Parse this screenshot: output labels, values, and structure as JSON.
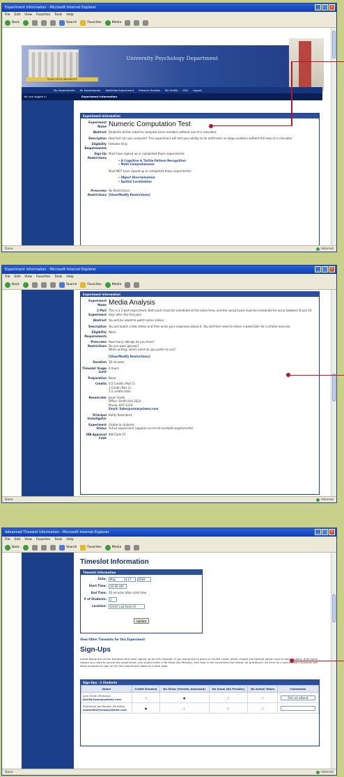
{
  "w1": {
    "title": "Experiment Information - Microsoft Internet Explorer",
    "menu": [
      "File",
      "Edit",
      "View",
      "Favorites",
      "Tools",
      "Help"
    ],
    "toolbar": {
      "back": "Back",
      "search": "Search",
      "favorites": "Favorites",
      "media": "Media"
    },
    "banner_title": "University Psychology Department",
    "banner_strip": "TEXAS TECH UNIVERSITY",
    "nav": [
      "My Experiments",
      "All Experiments",
      "Add/View Experiment",
      "Protocol Studies",
      "My Profile",
      "FAQ",
      "Logout"
    ],
    "logged_in": "You are logged in",
    "section": "Experiment Information",
    "panel_header": "Experiment Information",
    "name_k": "Experiment Name",
    "name_v": "Numeric Computation Test",
    "abstract_k": "Abstract",
    "abstract_v": "Students will be asked to compute some numbers without use of a calculator.",
    "desc_k": "Description",
    "desc_v": "How fast can you compute? This experiment will test your ability to do arithmetic on large numbers without the help of a calculator.",
    "elig_k": "Eligibility Requirements",
    "elig_v": "Females Only",
    "sign_k": "Sign-Up Restrictions",
    "sign_v": "Must have signed up or completed these experiments:",
    "sign_l1": "A Cognitive & Tactile Pattern Recognition",
    "sign_l2": "Math Comprehension",
    "sign_not": "Must NOT have signed up or completed these experiments:",
    "sign_l3": "Object Discrimination",
    "sign_l4": "Spatial Localization",
    "prescreen_k": "Prescreen Restrictions",
    "prescreen_v": "No Restrictions",
    "prescreen_link": "[View/Modify Restrictions]",
    "status": "Done",
    "zone": "Internet"
  },
  "w2": {
    "title": "Experiment Information - Microsoft Internet Explorer",
    "panel_header": "Experiment Information",
    "name_k": "Experiment Name",
    "name_v": "Media Analysis",
    "twopart_k": "2-Part Experiment",
    "twopart_v": "This is a 2-part experiment. Both parts must be scheduled at the same time, and the second part must be scheduled for occur between 8 and 10 days after the first part.",
    "abstract_k": "Abstract",
    "abstract_v": "You will be asked to watch some videos.",
    "desc_k": "Description",
    "desc_v": "You will watch a few videos and then write your responses about it. You will then need to return a week later for a similar exercise.",
    "elig_k": "Eligibility Requirements",
    "elig_v": "None",
    "pre_k": "Prescreen Restrictions",
    "pre_v1": "How many siblings do you have?",
    "pre_v2": "Do you wear glasses?",
    "pre_v3": "When writing, which hand do you prefer to use?",
    "pre_link": "[View/Modify Restrictions]",
    "dur_k": "Duration",
    "dur_v": "30 minutes",
    "tl_k": "Timeslot Usage Limit",
    "tl_v": "4 hours",
    "prep_k": "Preparation",
    "prep_v": "None",
    "cred_k": "Credits",
    "cred_v1": "0.5 Credits (Part 1)",
    "cred_v2": "1 Credit (Part 2)",
    "cred_v3": "1.5 credits total",
    "res_k": "Researcher",
    "res_v1": "Jason Smith",
    "res_v2": "Office: Smith Hall 302a",
    "res_v3": "Phone: 607-1234",
    "res_v4": "Email: Sales@sonasystems.com",
    "pi_k": "Principal Investigator",
    "pi_v": "Kathy Rosenburt",
    "es_k": "Experiment Status",
    "es_v1": "Visible to students",
    "es_v2": "Active experiment (appears on list of available experiments)",
    "irb_k": "IRB Approval Code",
    "irb_v": "IRB Code 07",
    "status": "Done",
    "zone": "Internet"
  },
  "w3": {
    "title": "Advanced Timeslot Information - Microsoft Internet Explorer",
    "heading": "Timeslot Information",
    "panel_header": "Timeslot Information",
    "date_k": "Date:",
    "date_m": "May",
    "date_d": "17",
    "date_y": "2004",
    "start_k": "Start Time:",
    "start_v": "10:00 AM",
    "end_k": "End Time:",
    "end_v": "30 minutes after start time",
    "num_k": "# of Students:",
    "num_v": "2",
    "loc_k": "Location:",
    "loc_v": "Smith Lab Room B",
    "update": "Update",
    "view_link": "View Other Timeslots for this Experiment",
    "signups": "Sign-Ups",
    "signups_text": "Listed below are all the students who have signed up for this timeslot. If you would like to grant or revoke credit, either choose the desired option next to each student. If for some reason you need to cancel the experiment, you should enter a No Show (No Penalty), and note in the comments the reason for granting it. An Error as a cancellation (Going on will allow students to sign up for this experiment again at a later date.",
    "tbl_caption": "Sign-Ups - 2 Students",
    "cols": [
      "Name",
      "Credit Granted",
      "No Show (Penalty Assessed)",
      "No Show (No Penalty)",
      "No Action Taken",
      "Comments"
    ],
    "r1_name": "John Smith (Pinkstar)",
    "r1_email": "jsmith@sonasystems.com",
    "r1_comment": "Did not attend",
    "r2_name": "Samantha Jan-Sander (Pinkstar)",
    "r2_email": "samantha@sonasystems.com",
    "status": "Done",
    "zone": "Internet"
  }
}
